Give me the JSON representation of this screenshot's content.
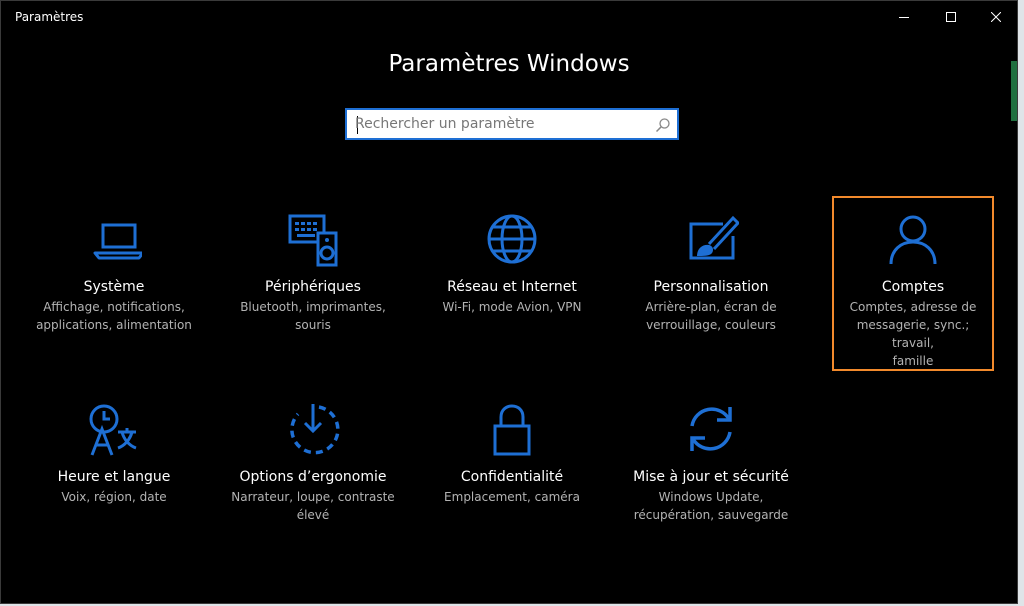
{
  "window": {
    "title": "Paramètres"
  },
  "page": {
    "heading": "Paramètres Windows"
  },
  "search": {
    "placeholder": "Rechercher un paramètre",
    "icon": "search-icon"
  },
  "accent_color": "#1e6fd4",
  "highlight_color": "#f28a2c",
  "tiles": [
    {
      "key": "systeme",
      "icon": "laptop-icon",
      "name": "Système",
      "desc_lines": [
        "Affichage, notifications,",
        "applications, alimentation"
      ]
    },
    {
      "key": "peripheriques",
      "icon": "devices-icon",
      "name": "Périphériques",
      "desc_lines": [
        "Bluetooth, imprimantes,",
        "souris"
      ]
    },
    {
      "key": "reseau",
      "icon": "globe-icon",
      "name": "Réseau et Internet",
      "desc_lines": [
        "Wi-Fi, mode Avion, VPN"
      ]
    },
    {
      "key": "personnalisation",
      "icon": "paint-icon",
      "name": "Personnalisation",
      "desc_lines": [
        "Arrière-plan, écran de",
        "verrouillage, couleurs"
      ]
    },
    {
      "key": "comptes",
      "icon": "person-icon",
      "name": "Comptes",
      "desc_lines": [
        "Comptes, adresse de",
        "messagerie, sync.; travail,",
        "famille"
      ],
      "highlighted": true
    },
    {
      "key": "heure",
      "icon": "time-language-icon",
      "name": "Heure et langue",
      "desc_lines": [
        "Voix, région, date"
      ]
    },
    {
      "key": "ergonomie",
      "icon": "ease-of-access-icon",
      "name": "Options d’ergonomie",
      "desc_lines": [
        "Narrateur, loupe, contraste",
        "élevé"
      ]
    },
    {
      "key": "confidentialite",
      "icon": "lock-icon",
      "name": "Confidentialité",
      "desc_lines": [
        "Emplacement, caméra"
      ]
    },
    {
      "key": "miseajour",
      "icon": "update-icon",
      "name": "Mise à jour et sécurité",
      "desc_lines": [
        "Windows Update,",
        "récupération, sauvegarde"
      ]
    }
  ]
}
